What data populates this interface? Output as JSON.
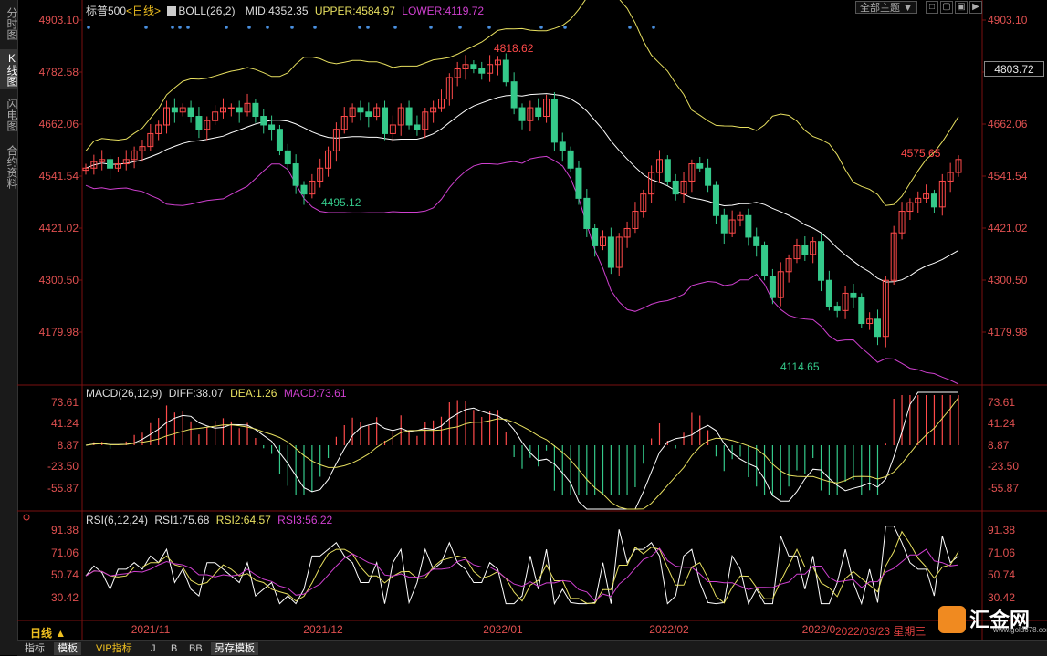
{
  "sidebar": {
    "tabs": [
      {
        "label": "分时图",
        "active": false
      },
      {
        "label": "K线图",
        "active": true
      },
      {
        "label": "闪电图",
        "active": false
      },
      {
        "label": "合约资料",
        "active": false
      }
    ]
  },
  "header": {
    "symbol": "标普500",
    "period": "<日线>",
    "indicator": "BOLL(26,2)",
    "mid": "MID:4352.35",
    "upper": "UPPER:4584.97",
    "lower": "LOWER:4119.72",
    "theme_button": "全部主题",
    "window_buttons": [
      "□",
      "▢",
      "▣",
      "▶"
    ]
  },
  "price_axis": {
    "labels": [
      "4903.10",
      "4782.58",
      "4662.06",
      "4541.54",
      "4421.02",
      "4300.50",
      "4179.98"
    ],
    "current_price": "4803.72"
  },
  "annotations": {
    "high": "4818.62",
    "low1": "4495.12",
    "low2": "4114.65",
    "recent_high": "4575.65"
  },
  "macd": {
    "title": "MACD(26,12,9)",
    "diff": "DIFF:38.07",
    "dea": "DEA:1.26",
    "macd": "MACD:73.61",
    "labels": [
      "73.61",
      "41.24",
      "8.87",
      "-23.50",
      "-55.87"
    ]
  },
  "rsi": {
    "title": "RSI(6,12,24)",
    "rsi1": "RSI1:75.68",
    "rsi2": "RSI2:64.57",
    "rsi3": "RSI3:56.22",
    "labels": [
      "91.38",
      "71.06",
      "50.74",
      "30.42"
    ]
  },
  "time_axis": {
    "labels": [
      "2021/11",
      "2021/12",
      "2022/01",
      "2022/02",
      "2022/0"
    ],
    "period_label": "日线 ▲",
    "cursor_date": "2022/03/23 星期三"
  },
  "bottom_tabs": [
    {
      "label": "指标",
      "active": false
    },
    {
      "label": "模板",
      "active": true
    },
    {
      "label": "VIP指标",
      "active": false,
      "color": "#f0c020"
    },
    {
      "label": "J",
      "active": false
    },
    {
      "label": "B",
      "active": false
    },
    {
      "label": "BB",
      "active": false
    },
    {
      "label": "另存模板",
      "active": true
    }
  ],
  "logo": {
    "text": "汇金网",
    "url": "www.gold678.com"
  },
  "colors": {
    "up": "#ff4a4a",
    "down": "#34c98a",
    "mid_line": "#ffffff",
    "upper_line": "#e8e060",
    "lower_line": "#d040d0",
    "grid": "#7a1010"
  }
}
